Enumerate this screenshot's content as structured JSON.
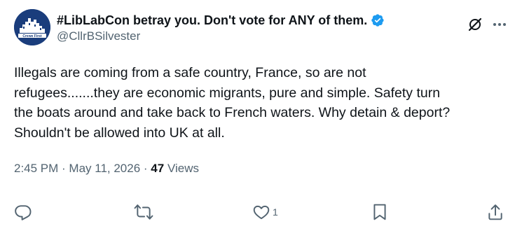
{
  "author": {
    "display_name": "#LibLabCon betray you. Don't vote for ANY of them.",
    "handle": "@CllrBSilvester",
    "avatar_text": "Crewe First",
    "verified_color": "#1d9bf0"
  },
  "tweet": {
    "lines": [
      "Illegals are coming from a safe country, France, so are not",
      "refugees.......they are economic migrants, pure and simple. Safety turn",
      "the boats around and take back to French waters. Why detain & deport?",
      "Shouldn't be allowed into UK at all."
    ]
  },
  "meta": {
    "time": "2:45 PM",
    "separator": " · ",
    "date": "May 11, 2026",
    "views_count": "47",
    "views_label": " Views"
  },
  "actions": {
    "reply_icon": "reply-icon",
    "retweet_icon": "retweet-icon",
    "like_icon": "like-icon",
    "like_count": "1",
    "bookmark_icon": "bookmark-icon",
    "share_icon": "share-icon"
  },
  "icons": {
    "grok": "grok-icon",
    "more": "more-icon"
  },
  "colors": {
    "text": "#0f1419",
    "secondary": "#536471",
    "avatar_bg": "#1a3d7c"
  }
}
